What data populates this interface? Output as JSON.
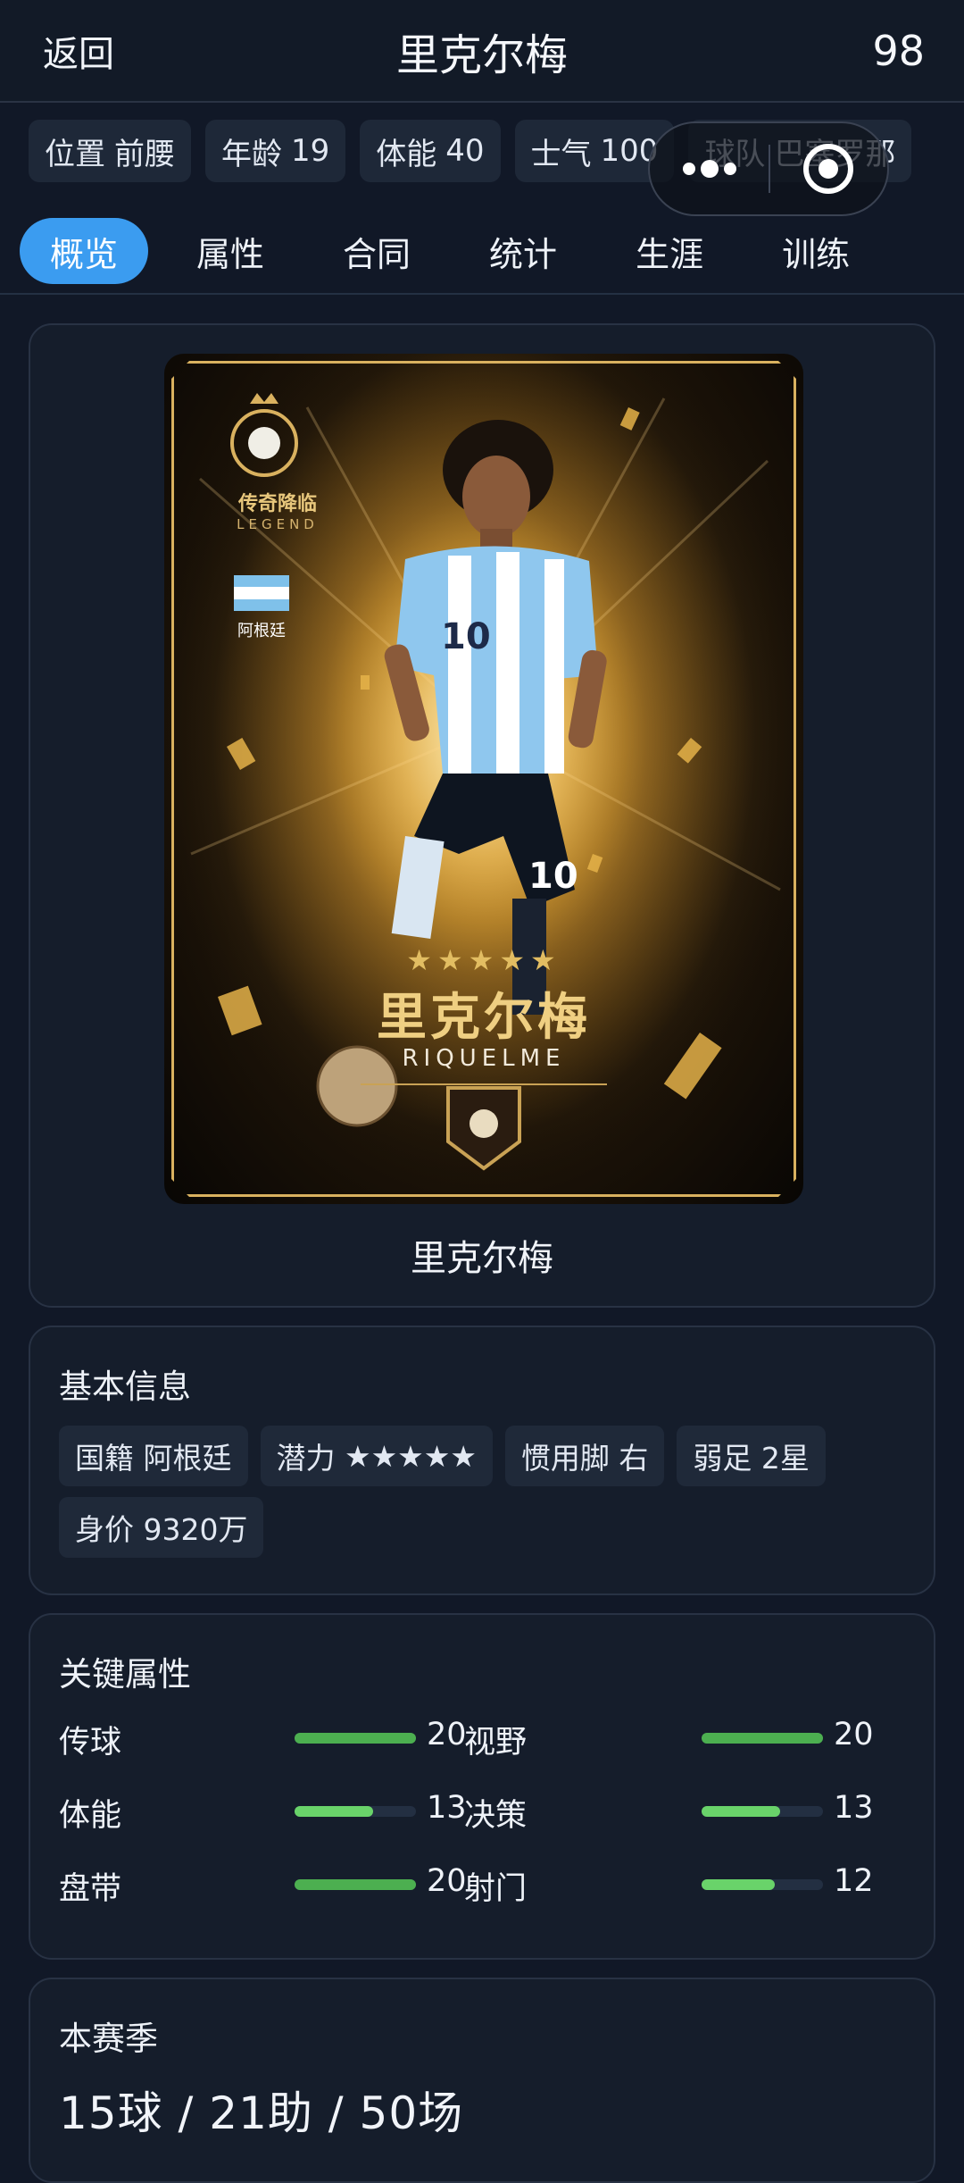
{
  "header": {
    "back_label": "返回",
    "title": "里克尔梅",
    "rating": "98"
  },
  "chips": [
    {
      "key": "位置",
      "value": "前腰"
    },
    {
      "key": "年龄",
      "value": "19"
    },
    {
      "key": "体能",
      "value": "40"
    },
    {
      "key": "士气",
      "value": "100"
    },
    {
      "key": "球队",
      "value": "巴塞罗那"
    }
  ],
  "capsule": {
    "more_icon": "more-dots-icon",
    "close_icon": "close-target-icon"
  },
  "tabs": [
    {
      "label": "概览",
      "active": true
    },
    {
      "label": "属性",
      "active": false
    },
    {
      "label": "合同",
      "active": false
    },
    {
      "label": "统计",
      "active": false
    },
    {
      "label": "生涯",
      "active": false
    },
    {
      "label": "训练",
      "active": false
    }
  ],
  "hero": {
    "card": {
      "badge_title": "传奇降临",
      "badge_subtitle": "LEGEND",
      "flag_label": "阿根廷",
      "stars": "★★★★★",
      "name": "里克尔梅",
      "latin_name": "RIQUELME",
      "shirt_number": "10"
    },
    "name": "里克尔梅"
  },
  "basic_info": {
    "title": "基本信息",
    "row1": [
      {
        "key": "国籍",
        "value": "阿根廷"
      },
      {
        "key": "潜力",
        "value": "★★★★★"
      },
      {
        "key": "惯用脚",
        "value": "右"
      },
      {
        "key": "弱足",
        "value": "2星"
      }
    ],
    "row2": [
      {
        "key": "身价",
        "value": "9320万"
      }
    ]
  },
  "key_attributes": {
    "title": "关键属性",
    "max": 20,
    "left": [
      {
        "label": "传球",
        "value": "20",
        "fill": 1.0
      },
      {
        "label": "体能",
        "value": "13",
        "fill": 0.65
      },
      {
        "label": "盘带",
        "value": "20",
        "fill": 1.0
      }
    ],
    "right": [
      {
        "label": "视野",
        "value": "20",
        "fill": 1.0
      },
      {
        "label": "决策",
        "value": "13",
        "fill": 0.65
      },
      {
        "label": "射门",
        "value": "12",
        "fill": 0.6
      }
    ],
    "colors": {
      "full": "#4caf50",
      "partial": "#69d36a",
      "track": "#232f42"
    }
  },
  "season": {
    "title": "本赛季",
    "stats": "15球 / 21助 / 50场"
  }
}
